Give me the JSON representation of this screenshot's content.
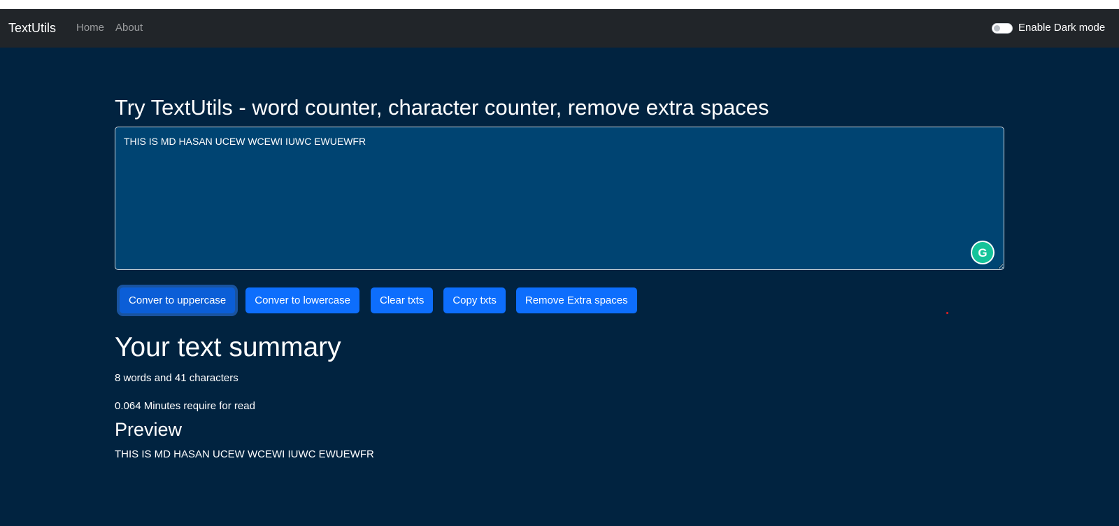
{
  "navbar": {
    "brand": "TextUtils",
    "links": [
      {
        "label": "Home"
      },
      {
        "label": "About"
      }
    ],
    "dark_mode_label": "Enable Dark mode"
  },
  "main": {
    "title": "Try TextUtils - word counter, character counter, remove extra spaces",
    "textarea_value": "THIS IS MD HASAN UCEW WCEWI IUWC EWUEWFR",
    "buttons": [
      {
        "label": "Conver to uppercase"
      },
      {
        "label": "Conver to lowercase"
      },
      {
        "label": "Clear txts"
      },
      {
        "label": "Copy txts"
      },
      {
        "label": "Remove Extra spaces"
      }
    ],
    "summary_title": "Your text summary",
    "word_char_count": "8 words and 41 characters",
    "read_time": "0.064 Minutes require for read",
    "preview_title": "Preview",
    "preview_text": "THIS IS MD HASAN UCEW WCEWI IUWC EWUEWFR"
  },
  "icons": {
    "grammarly": "grammarly-icon"
  },
  "colors": {
    "navbar_bg": "#212529",
    "page_bg": "#012340",
    "textarea_bg": "#004472",
    "button_bg": "#0d6efd"
  }
}
